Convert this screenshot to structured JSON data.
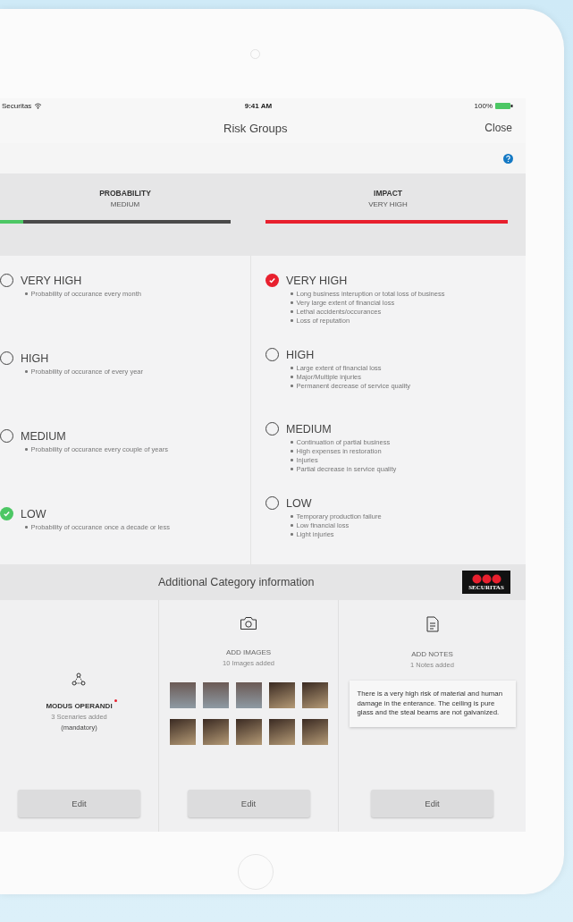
{
  "status_bar": {
    "carrier": "Securitas",
    "time": "9:41 AM",
    "battery": "100%"
  },
  "nav": {
    "title": "Risk Groups",
    "close": "Close"
  },
  "meters": [
    {
      "title": "PROBABILITY",
      "value": "MEDIUM",
      "level": 0.1,
      "color": "#4cc764"
    },
    {
      "title": "IMPACT",
      "value": "VERY HIGH",
      "level": 1,
      "color": "#e8202e"
    }
  ],
  "columns": [
    [
      {
        "label": "VERY HIGH",
        "selected": false,
        "bullets": [
          "Probability of occurance every month"
        ]
      },
      {
        "label": "HIGH",
        "selected": false,
        "bullets": [
          "Probability of occurance of every year"
        ]
      },
      {
        "label": "MEDIUM",
        "selected": false,
        "bullets": [
          "Probability of occurance every couple of years"
        ]
      },
      {
        "label": "LOW",
        "selected": true,
        "bullets": [
          "Probability of occurance once a decade or less"
        ]
      }
    ],
    [
      {
        "label": "VERY HIGH",
        "selected": true,
        "bullets": [
          "Long business interuption or total loss of business",
          "Very large extent of financial loss",
          "Lethal accidents/occurances",
          "Loss of reputation"
        ]
      },
      {
        "label": "HIGH",
        "selected": false,
        "bullets": [
          "Large extent of financial loss",
          "Major/Multiple injuries",
          "Permanent decrease of service quality"
        ]
      },
      {
        "label": "MEDIUM",
        "selected": false,
        "bullets": [
          "Continuation of partial business",
          "High expenses in restoration",
          "Injuries",
          "Partial decrease in service quality"
        ]
      },
      {
        "label": "LOW",
        "selected": false,
        "bullets": [
          "Temporary production failure",
          "Low financial loss",
          "Light injuries"
        ]
      }
    ]
  ],
  "additional": {
    "title": "Additional Category information",
    "logo_text": "SECURITAS",
    "cards": [
      {
        "kind": "modus",
        "title": "MODUS OPERANDI",
        "required": true,
        "subtitle": "3 Scenaries added",
        "note": "(mandatory)",
        "button": "Edit"
      },
      {
        "kind": "images",
        "title": "ADD IMAGES",
        "subtitle": "10 Images added",
        "button": "Edit"
      },
      {
        "kind": "notes",
        "title": "ADD NOTES",
        "subtitle": "1 Notes added",
        "note": "There is a very high risk of material and human damage in the enterance. The ceiling is pure glass and the steal beams are not galvanized.",
        "button": "Edit"
      }
    ]
  }
}
